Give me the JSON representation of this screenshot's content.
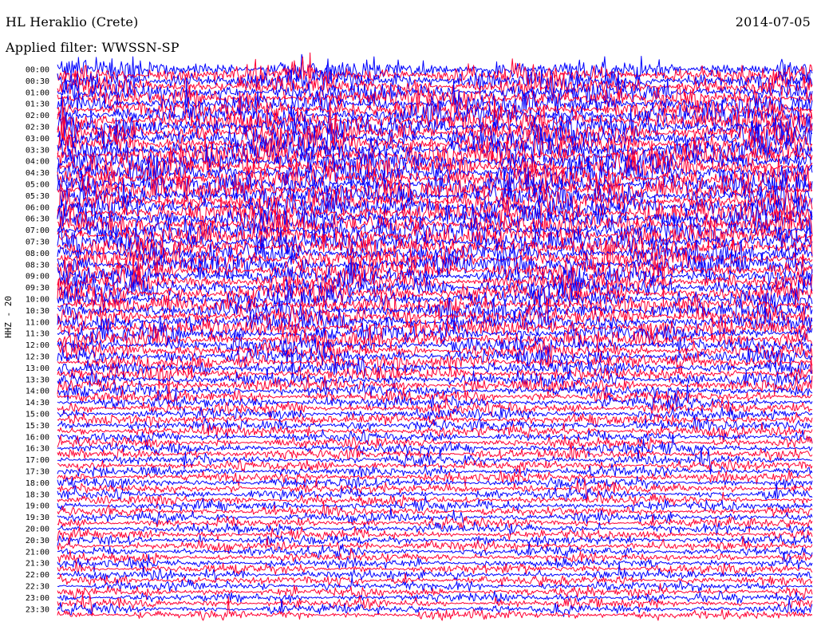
{
  "header": {
    "station": "HL Heraklio (Crete)",
    "date": "2014-07-05",
    "filter": "Applied filter: WWSSN-SP"
  },
  "channel_label": "HHZ - 20",
  "chart_data": {
    "type": "line",
    "title": "HL Heraklio (Crete)",
    "subtitle": "Applied filter: WWSSN-SP",
    "date": "2014-07-05",
    "ylabel": "HHZ - 20",
    "row_interval_minutes": 15,
    "row_count": 96,
    "labeled_rows": [
      "00:00",
      "00:30",
      "01:00",
      "01:30",
      "02:00",
      "02:30",
      "03:00",
      "03:30",
      "04:00",
      "04:30",
      "05:00",
      "05:30",
      "06:00",
      "06:30",
      "07:00",
      "07:30",
      "08:00",
      "08:30",
      "09:00",
      "09:30",
      "10:00",
      "10:30",
      "11:00",
      "11:30",
      "12:00",
      "12:30",
      "13:00",
      "13:30",
      "14:00",
      "14:30",
      "15:00",
      "15:30",
      "16:00",
      "16:30",
      "17:00",
      "17:30",
      "18:00",
      "18:30",
      "19:00",
      "19:30",
      "20:00",
      "20:30",
      "21:00",
      "21:30",
      "22:00",
      "22:30",
      "23:00",
      "23:30"
    ],
    "trace_colors": [
      "#0000ff",
      "#ff0033"
    ],
    "relative_amplitude_by_hour": [
      1.0,
      1.0,
      1.15,
      1.2,
      1.2,
      1.15,
      1.15,
      1.1,
      1.05,
      1.0,
      0.95,
      0.9,
      0.8,
      0.7,
      0.6,
      0.55,
      0.5,
      0.48,
      0.47,
      0.46,
      0.45,
      0.44,
      0.44,
      0.43
    ],
    "grid": false,
    "legend": "none"
  }
}
